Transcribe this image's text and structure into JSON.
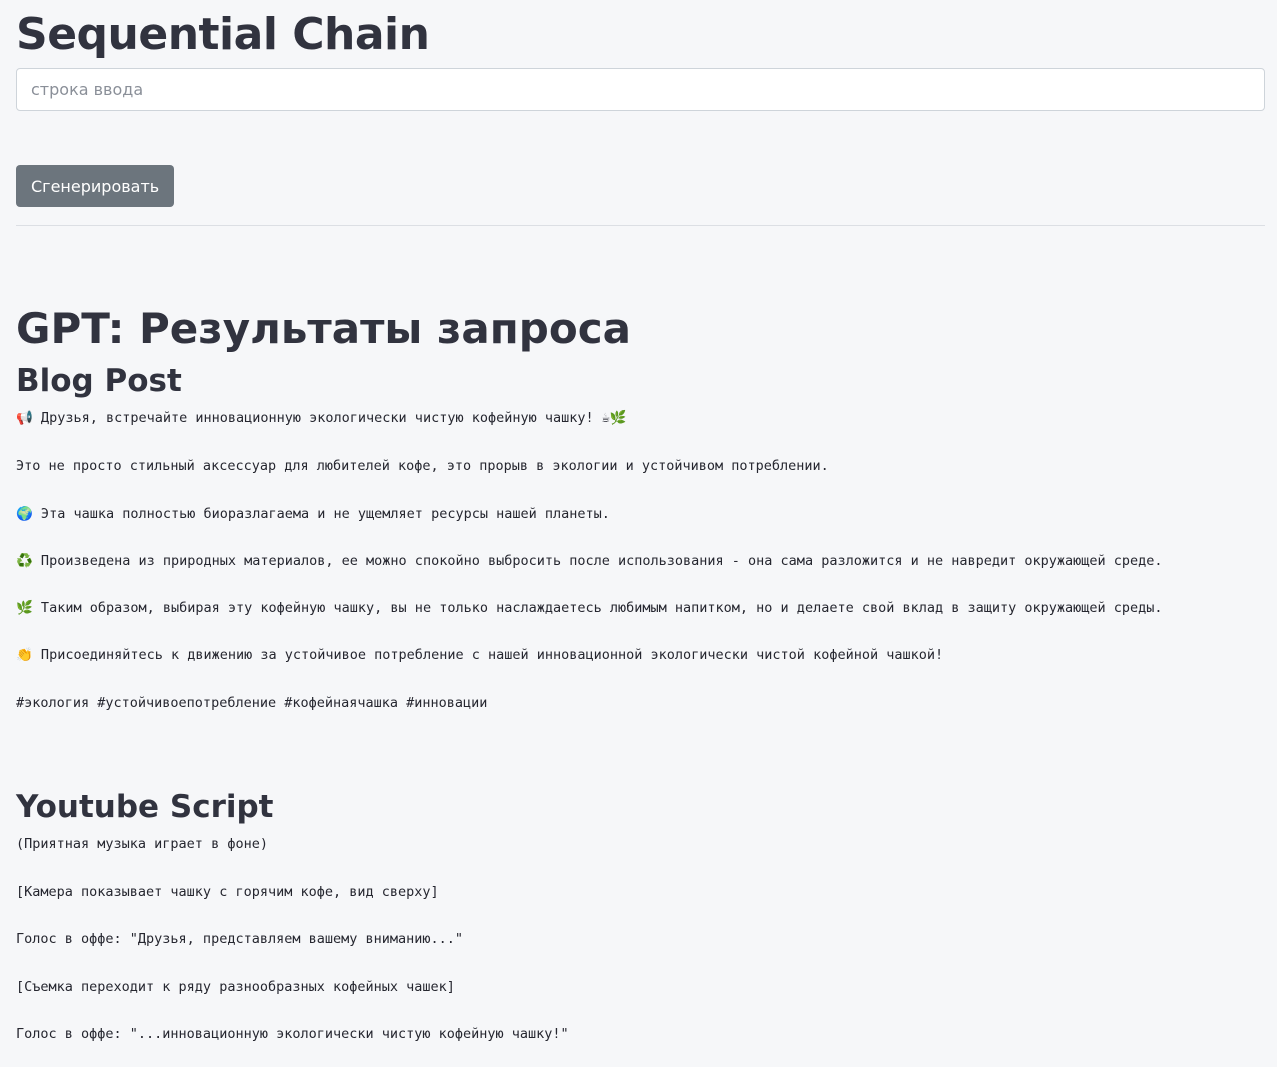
{
  "app": {
    "title": "Sequential Chain",
    "input_placeholder": "строка ввода",
    "input_value": "",
    "generate_label": "Сгенерировать"
  },
  "results": {
    "title": "GPT: Результаты запроса",
    "blog": {
      "title": "Blog Post",
      "lines": [
        "📢 Друзья, встречайте инновационную экологически чистую кофейную чашку! ☕🌿",
        "Это не просто стильный аксессуар для любителей кофе, это прорыв в экологии и устойчивом потреблении.",
        "🌍 Эта чашка полностью биоразлагаема и не ущемляет ресурсы нашей планеты.",
        "♻️ Произведена из природных материалов, ее можно спокойно выбросить после использования - она сама разложится и не навредит окружающей среде.",
        "🌿 Таким образом, выбирая эту кофейную чашку, вы не только наслаждаетесь любимым напитком, но и делаете свой вклад в защиту окружающей среды.",
        "👏 Присоединяйтесь к движению за устойчивое потребление с нашей инновационной экологически чистой кофейной чашкой!",
        "#экология #устойчивоепотребление #кофейнаячашка #инновации"
      ]
    },
    "youtube": {
      "title": "Youtube Script",
      "lines": [
        "(Приятная музыка играет в фоне)",
        "[Камера показывает чашку с горячим кофе, вид сверху]",
        "Голос в оффе: \"Друзья, представляем вашему вниманию...\"",
        "[Съемка переходит к ряду разнообразных кофейных чашек]",
        "Голос в оффе: \"...инновационную экологически чистую кофейную чашку!\""
      ]
    }
  }
}
